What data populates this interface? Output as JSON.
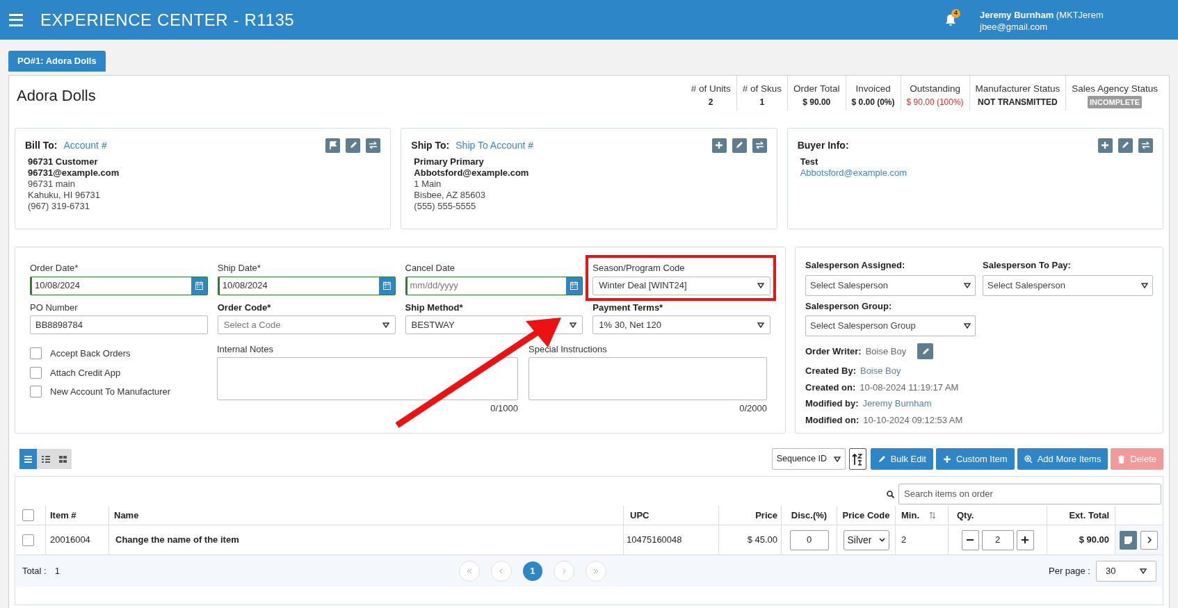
{
  "header": {
    "title": "EXPERIENCE CENTER - R1135",
    "notification_count": "4",
    "user_name": "Jeremy Burnham",
    "user_code": "(MKTJerem",
    "user_email": "jbee@gmail.com"
  },
  "tabs": [
    {
      "label": "PO#1: Adora Dolls",
      "selected": true
    }
  ],
  "order": {
    "title": "Adora Dolls",
    "stats": [
      {
        "label": "# of Units",
        "value": "2",
        "kind": "plain"
      },
      {
        "label": "# of Skus",
        "value": "1",
        "kind": "plain"
      },
      {
        "label": "Order Total",
        "value": "$ 90.00",
        "kind": "plain"
      },
      {
        "label": "Invoiced",
        "value": "$ 0.00 (0%)",
        "kind": "plain"
      },
      {
        "label": "Outstanding",
        "value": "$ 90.00 (100%)",
        "kind": "alert"
      },
      {
        "label": "Manufacturer Status",
        "value": "NOT TRANSMITTED",
        "kind": "plain"
      },
      {
        "label": "Sales Agency Status",
        "value": "INCOMPLETE",
        "kind": "badge"
      }
    ]
  },
  "cards": [
    {
      "title": "Bill To:",
      "link": "Account #",
      "lines": [
        {
          "text": "96731 Customer",
          "kind": "bold"
        },
        {
          "text": "96731@example.com",
          "kind": "bold"
        },
        {
          "text": "96731 main",
          "kind": "plain"
        },
        {
          "text": "Kahuku, HI 96731",
          "kind": "plain"
        },
        {
          "text": "(967) 319-6731",
          "kind": "plain"
        }
      ]
    },
    {
      "title": "Ship To:",
      "link": "Ship To Account #",
      "lines": [
        {
          "text": "Primary Primary",
          "kind": "bold"
        },
        {
          "text": "Abbotsford@example.com",
          "kind": "bold"
        },
        {
          "text": "1 Main",
          "kind": "plain"
        },
        {
          "text": "Bisbee, AZ 85603",
          "kind": "plain"
        },
        {
          "text": "(555) 555-5555",
          "kind": "plain"
        }
      ]
    },
    {
      "title": "Buyer Info:",
      "lines": [
        {
          "text": "Test",
          "kind": "bold"
        },
        {
          "text": "Abbotsford@example.com",
          "kind": "link"
        }
      ]
    }
  ],
  "form": {
    "fields": [
      {
        "label": "Order Date*",
        "kind": "date",
        "value": "10/08/2024",
        "emphasis": false
      },
      {
        "label": "Ship Date*",
        "kind": "date",
        "value": "10/08/2024",
        "emphasis": false
      },
      {
        "label": "Cancel Date",
        "kind": "date",
        "placeholder": "mm/dd/yyyy",
        "emphasis": false
      },
      {
        "label": "Season/Program Code",
        "kind": "select",
        "value": "Winter Deal [WINT24]",
        "emphasis": false
      },
      {
        "label": "PO Number",
        "kind": "text",
        "value": "BB8898784",
        "emphasis": false
      },
      {
        "label": "Order Code*",
        "kind": "select",
        "placeholder": "Select a Code",
        "emphasis": true
      },
      {
        "label": "Ship Method*",
        "kind": "select",
        "value": "BESTWAY",
        "emphasis": true
      },
      {
        "label": "Payment Terms*",
        "kind": "select",
        "value": "1% 30, Net 120",
        "emphasis": true
      }
    ],
    "checkboxes": [
      {
        "label": "Accept Back Orders",
        "checked": false
      },
      {
        "label": "Attach Credit App",
        "checked": false
      },
      {
        "label": "New Account To Manufacturer",
        "checked": false
      }
    ],
    "notes": [
      {
        "label": "Internal Notes",
        "counter": "0/1000"
      },
      {
        "label": "Special Instructions",
        "counter": "0/2000"
      }
    ]
  },
  "sales": {
    "selects": [
      {
        "label": "Salesperson Assigned:",
        "placeholder": "Select Salesperson"
      },
      {
        "label": "Salesperson To Pay:",
        "placeholder": "Select Salesperson"
      },
      {
        "label": "Salesperson Group:",
        "placeholder": "Select Salesperson Group"
      }
    ],
    "order_writer": {
      "label": "Order Writer:",
      "value": "Boise Boy"
    },
    "meta": [
      {
        "label": "Created By:",
        "value": "Boise Boy",
        "kind": "link"
      },
      {
        "label": "Created on:",
        "value": "10-08-2024 11:19:17 AM",
        "kind": "plain"
      },
      {
        "label": "Modified by:",
        "value": "Jeremy Burnham",
        "kind": "link"
      },
      {
        "label": "Modified on:",
        "value": "10-10-2024 09:12:53 AM",
        "kind": "plain"
      }
    ]
  },
  "items": {
    "views": [
      {
        "selected": true
      },
      {
        "selected": false
      },
      {
        "selected": false
      }
    ],
    "sort": "Sequence ID",
    "buttons": [
      {
        "label": "Bulk Edit",
        "disabled": false
      },
      {
        "label": "Custom Item",
        "disabled": false
      },
      {
        "label": "Add More Items",
        "disabled": false
      },
      {
        "label": "Delete",
        "disabled": true
      }
    ],
    "all_checked": false,
    "search_placeholder": "Search items on order",
    "columns": [
      "Item #",
      "Name",
      "UPC",
      "Price",
      "Disc.(%)",
      "Price Code",
      "Min.",
      "Qty.",
      "Ext. Total"
    ],
    "rows": [
      {
        "checked": false,
        "item": "20016004",
        "name": "Change the name of the item",
        "upc": "10475160048",
        "price": "$ 45.00",
        "disc": "0",
        "price_code": "Silver",
        "min": "2",
        "qty": "2",
        "ext_total": "$ 90.00"
      }
    ],
    "footer": {
      "total_label": "Total :",
      "total": "1",
      "pages": [
        {
          "label": "1",
          "selected": true
        }
      ],
      "per_page_label": "Per page :",
      "per_page": "30"
    }
  }
}
